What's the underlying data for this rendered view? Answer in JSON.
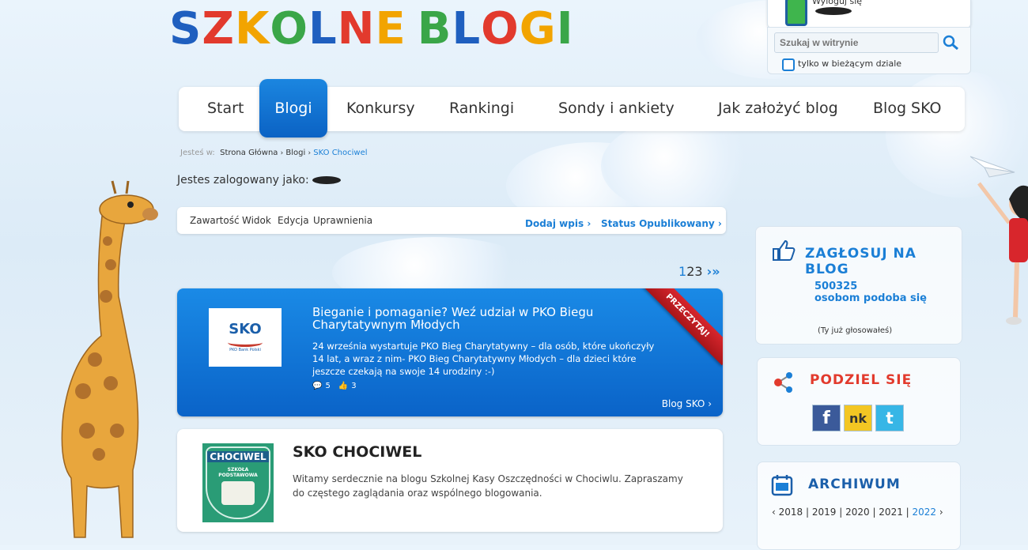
{
  "logo": {
    "letters": [
      "S",
      "Z",
      "K",
      "O",
      "L",
      "N",
      "E",
      " ",
      "B",
      "L",
      "O",
      "G",
      "I"
    ]
  },
  "header": {
    "login_label": "Wyloguj się",
    "search_placeholder": "Szukaj w witrynie",
    "search_scope_label": "tylko w bieżącym dziale"
  },
  "nav": {
    "items": [
      "Start",
      "Blogi",
      "Konkursy",
      "Rankingi",
      "Sondy i ankiety",
      "Jak założyć blog",
      "Blog SKO"
    ],
    "active": "Blogi"
  },
  "breadcrumb": {
    "prefix": "Jesteś w:",
    "items": [
      "Strona Główna",
      "Blogi",
      "SKO Chociwel"
    ]
  },
  "logged_in": {
    "label": "Jestes zalogowany jako:"
  },
  "toolbar": {
    "items": [
      "Zawartość",
      "Widok",
      "Edycja",
      "Uprawnienia"
    ],
    "add_entry": "Dodaj wpis",
    "status": "Status Opublikowany"
  },
  "pagination": {
    "pages": [
      "1",
      "2",
      "3"
    ],
    "current": "1"
  },
  "featured": {
    "title": "Bieganie i pomaganie? Weź udział w PKO Biegu Charytatywnym Młodych",
    "text": "24 września wystartuje PKO Bieg Charytatywny – dla osób, które ukończyły 14 lat, a wraz z nim- PKO Bieg Charytatywny Młodych – dla dzieci które jeszcze czekają na swoje 14 urodziny :-)",
    "comments": "5",
    "likes": "3",
    "ribbon": "PRZECZYTAJ!",
    "blog_link": "Blog SKO",
    "logo_text": "SKO",
    "logo_sub": "PKO Bank Polski"
  },
  "blog": {
    "title": "SKO CHOCIWEL",
    "text": "Witamy serdecznie na blogu Szkolnej Kasy Oszczędności w Chociwlu. Zapraszamy do częstego zaglądania oraz wspólnego blogowania.",
    "badge_top": "CHOCIWEL",
    "badge_sub": "SZKOŁA PODSTAWOWA"
  },
  "vote": {
    "title": "ZAGŁOSUJ NA BLOG",
    "count": "500325",
    "count_label": "osobom podoba się",
    "note": "(Ty już głosowałeś)"
  },
  "share": {
    "title": "PODZIEL SIĘ",
    "buttons": [
      "f",
      "nk",
      "t"
    ]
  },
  "archive": {
    "title": "ARCHIWUM",
    "years": [
      "2018",
      "2019",
      "2020",
      "2021",
      "2022"
    ],
    "current": "2022"
  }
}
